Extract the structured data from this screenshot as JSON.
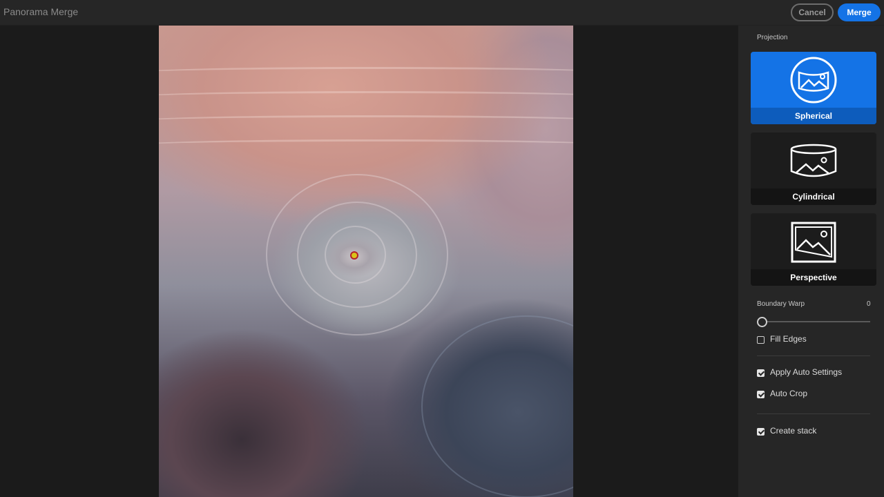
{
  "header": {
    "title": "Panorama Merge",
    "cancel_label": "Cancel",
    "merge_label": "Merge"
  },
  "panel": {
    "projection_label": "Projection",
    "projections": [
      {
        "label": "Spherical",
        "selected": true,
        "icon": "spherical-projection-icon"
      },
      {
        "label": "Cylindrical",
        "selected": false,
        "icon": "cylindrical-projection-icon"
      },
      {
        "label": "Perspective",
        "selected": false,
        "icon": "perspective-projection-icon"
      }
    ],
    "boundary_warp": {
      "label": "Boundary Warp",
      "value": "0",
      "fraction": 0
    },
    "fill_edges": {
      "label": "Fill Edges",
      "checked": false
    },
    "apply_auto_settings": {
      "label": "Apply Auto Settings",
      "checked": true
    },
    "auto_crop": {
      "label": "Auto Crop",
      "checked": true
    },
    "create_stack": {
      "label": "Create stack",
      "checked": true
    }
  },
  "colors": {
    "accent": "#1473e6",
    "panel_bg": "#262626",
    "canvas_bg": "#1b1b1b"
  }
}
